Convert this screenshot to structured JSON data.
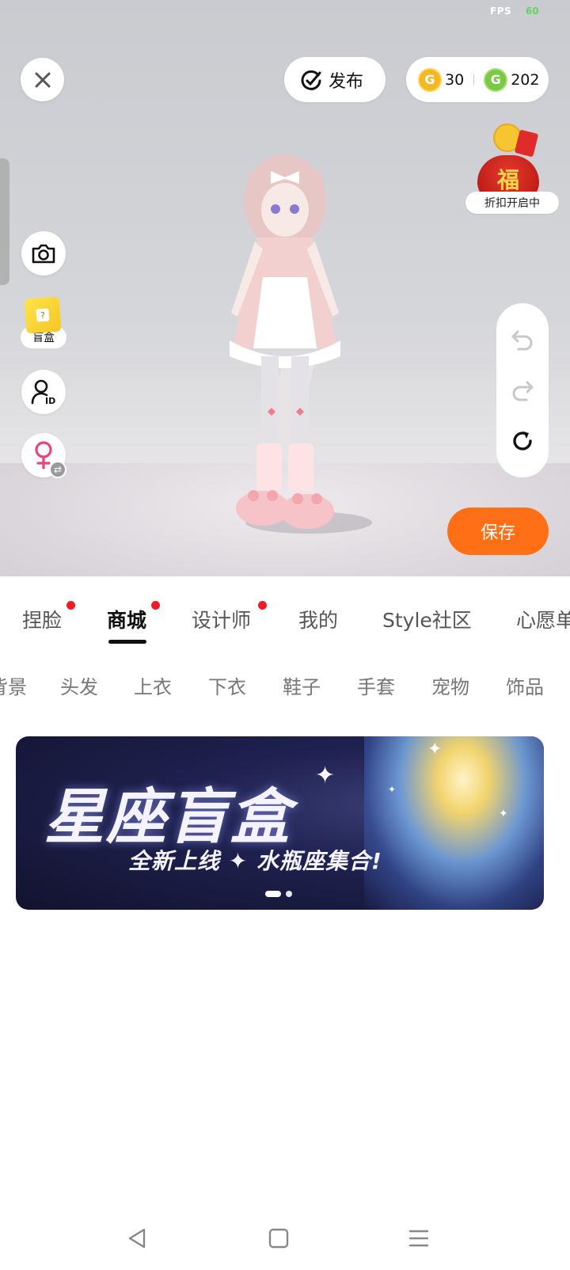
{
  "status": {
    "fps_label": "FPS",
    "fps_value": "60"
  },
  "top": {
    "publish_label": "发布",
    "wallet": {
      "gold_value": "30",
      "green_value": "202",
      "gold_icon": "G",
      "green_icon": "G"
    }
  },
  "promo": {
    "label": "折扣开启中",
    "bag_char": "福"
  },
  "left_tools": {
    "blindbox_label": "盲盒",
    "blindbox_icon": "?"
  },
  "save_label": "保存",
  "tabs": [
    {
      "label": "捏脸",
      "dot": true
    },
    {
      "label": "商城",
      "dot": true,
      "active": true
    },
    {
      "label": "设计师",
      "dot": true
    },
    {
      "label": "我的",
      "dot": false
    },
    {
      "label": "Style社区",
      "dot": false
    },
    {
      "label": "心愿单",
      "dot": false
    }
  ],
  "categories": [
    "背景",
    "头发",
    "上衣",
    "下衣",
    "鞋子",
    "手套",
    "宠物",
    "饰品"
  ],
  "banner": {
    "title": "星座盲盒",
    "subtitle": "全新上线 ✦ 水瓶座集合!",
    "page_count": 2,
    "active_page": 1
  },
  "colors": {
    "accent": "#ff7016",
    "badge": "#ee1c25",
    "gold": "#f4b820",
    "green": "#7ac943"
  }
}
